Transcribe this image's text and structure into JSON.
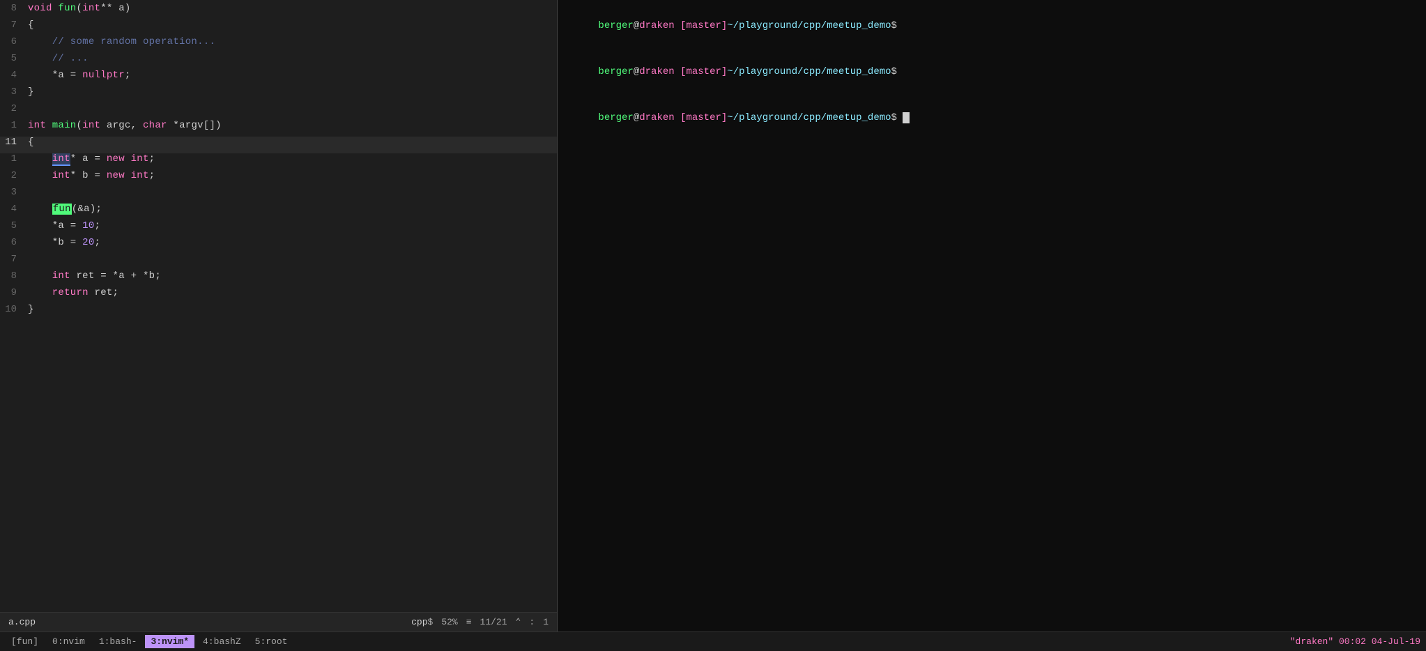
{
  "editor": {
    "filename": "a.cpp",
    "filetype": "cpp",
    "scroll_percent": "52%",
    "position": "11/21",
    "column": "1",
    "lines": [
      {
        "num": "8",
        "content": "void fun(int** a)",
        "active": false
      },
      {
        "num": "7",
        "content": "{",
        "active": false
      },
      {
        "num": "6",
        "content": "    // some random operation...",
        "active": false
      },
      {
        "num": "5",
        "content": "    // ...",
        "active": false
      },
      {
        "num": "4",
        "content": "    *a = nullptr;",
        "active": false
      },
      {
        "num": "3",
        "content": "}",
        "active": false
      },
      {
        "num": "2",
        "content": "",
        "active": false
      },
      {
        "num": "1",
        "content": "int main(int argc, char *argv[])",
        "active": false
      },
      {
        "num": "11",
        "content": "{",
        "active": true
      },
      {
        "num": "1",
        "content": "    int* a = new int;",
        "active": false
      },
      {
        "num": "2",
        "content": "    int* b = new int;",
        "active": false
      },
      {
        "num": "3",
        "content": "",
        "active": false
      },
      {
        "num": "4",
        "content": "    fun(&a);",
        "active": false
      },
      {
        "num": "5",
        "content": "    *a = 10;",
        "active": false
      },
      {
        "num": "6",
        "content": "    *b = 20;",
        "active": false
      },
      {
        "num": "7",
        "content": "",
        "active": false
      },
      {
        "num": "8",
        "content": "    int ret = *a + *b;",
        "active": false
      },
      {
        "num": "9",
        "content": "    return ret;",
        "active": false
      },
      {
        "num": "10",
        "content": "}",
        "active": false
      }
    ]
  },
  "terminal": {
    "lines": [
      "berger@draken [master]~/playground/cpp/meetup_demo$",
      "berger@draken [master]~/playground/cpp/meetup_demo$",
      "berger@draken [master]~/playground/cpp/meetup_demo$"
    ]
  },
  "tmux": {
    "windows": [
      {
        "label": "[fun]",
        "index": "0",
        "name": "nvim",
        "active": false
      },
      {
        "label": "1:bash-",
        "active": false
      },
      {
        "label": "3:nvim*",
        "active": true
      },
      {
        "label": "4:bashZ",
        "active": false
      },
      {
        "label": "5:root",
        "active": false
      }
    ],
    "session": "draken",
    "time": "00:02",
    "date": "04-Jul-19"
  }
}
